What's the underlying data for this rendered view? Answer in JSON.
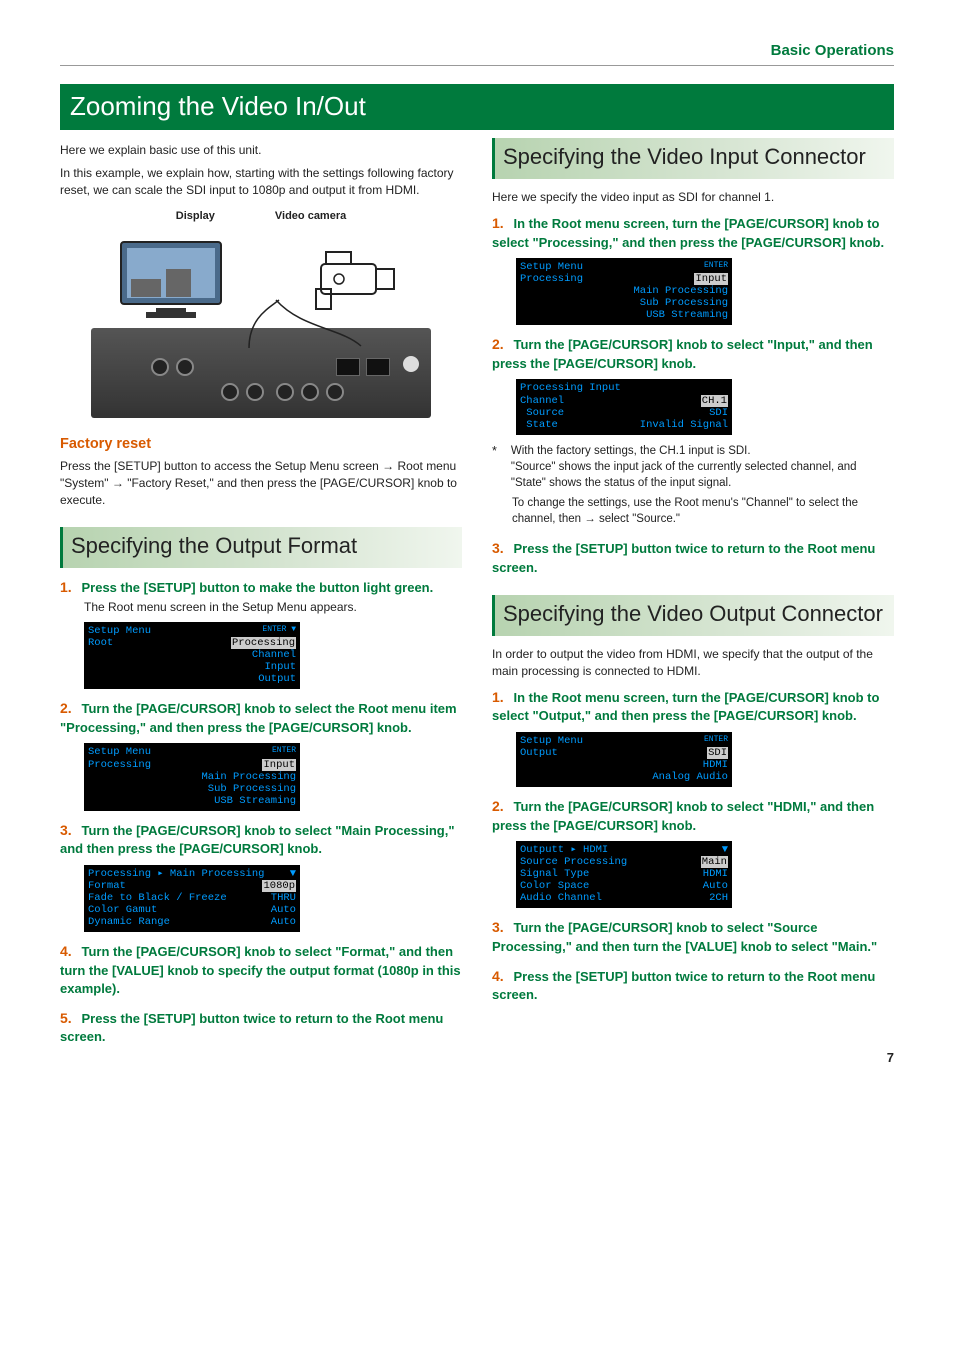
{
  "header": {
    "section": "Basic Operations"
  },
  "title": "Zooming the Video In/Out",
  "intro": {
    "p1": "Here we explain basic use of this unit.",
    "p2": "In this example, we explain how, starting with the settings following factory reset, we can scale the SDI input to 1080p and output it from HDMI."
  },
  "diagram": {
    "display_label": "Display",
    "camera_label": "Video camera"
  },
  "factory_reset": {
    "heading": "Factory reset",
    "body_a": "Press the [SETUP] button to access the Setup Menu screen ",
    "body_b": " Root menu \"System\" ",
    "body_c": " \"Factory Reset,\" and then press the [PAGE/CURSOR] knob to execute."
  },
  "output_format": {
    "heading": "Specifying the Output Format",
    "steps": [
      {
        "num": "1.",
        "heading": "Press the [SETUP] button to make the button light green.",
        "body": "The Root menu screen in the Setup Menu appears."
      },
      {
        "num": "2.",
        "heading": "Turn the [PAGE/CURSOR] knob to select the Root menu item \"Processing,\" and then press the [PAGE/CURSOR] knob."
      },
      {
        "num": "3.",
        "heading": "Turn the [PAGE/CURSOR] knob to select \"Main Processing,\" and then press the [PAGE/CURSOR] knob."
      },
      {
        "num": "4.",
        "heading": "Turn the [PAGE/CURSOR] knob to select \"Format,\" and then turn the [VALUE] knob to specify the output format (1080p in this example)."
      },
      {
        "num": "5.",
        "heading": "Press the [SETUP] button twice to return to the Root menu screen."
      }
    ]
  },
  "input_connector": {
    "heading": "Specifying the Video Input Connector",
    "intro": "Here we specify the video input as SDI for channel 1.",
    "steps": [
      {
        "num": "1.",
        "heading": "In the Root menu screen, turn the [PAGE/CURSOR] knob to select \"Processing,\" and then press the [PAGE/CURSOR] knob."
      },
      {
        "num": "2.",
        "heading": "Turn the [PAGE/CURSOR] knob to select \"Input,\" and then press the [PAGE/CURSOR] knob."
      },
      {
        "num": "3.",
        "heading": "Press the [SETUP] button twice to return to the Root menu screen."
      }
    ],
    "note1": "With the factory settings, the CH.1 input is SDI.",
    "note2": "\"Source\" shows the input jack of the currently selected channel, and \"State\" shows the status of the input signal.",
    "note3a": "To change the settings, use the Root menu's \"Channel\" to select the channel, then ",
    "note3b": " select \"Source.\""
  },
  "output_connector": {
    "heading": "Specifying the Video Output Connector",
    "intro": "In order to output the video from HDMI, we specify that the output of the main processing is connected to HDMI.",
    "steps": [
      {
        "num": "1.",
        "heading": "In the Root menu screen, turn the [PAGE/CURSOR] knob to select \"Output,\" and then press the [PAGE/CURSOR] knob."
      },
      {
        "num": "2.",
        "heading": "Turn the [PAGE/CURSOR] knob to select \"HDMI,\" and then press the [PAGE/CURSOR] knob."
      },
      {
        "num": "3.",
        "heading": "Turn the [PAGE/CURSOR] knob to select \"Source Processing,\" and then turn the [VALUE] knob to select \"Main.\""
      },
      {
        "num": "4.",
        "heading": "Press the [SETUP] button twice to return to the Root menu screen."
      }
    ]
  },
  "menus": {
    "root": {
      "title": "Setup Menu",
      "enter": "ENTER ▼",
      "left": "Root",
      "items": [
        "Processing",
        "Channel",
        "Input",
        "Output"
      ]
    },
    "processing": {
      "title": "Setup Menu",
      "enter": "ENTER",
      "left": "Processing",
      "items": [
        "Input",
        "Main Processing",
        "Sub Processing",
        "USB Streaming"
      ]
    },
    "main_proc": {
      "title": "Processing ▸ Main Processing",
      "arrow": "▼",
      "rows": [
        [
          "Format",
          "1080p"
        ],
        [
          "Fade to Black / Freeze",
          "THRU"
        ],
        [
          "Color Gamut",
          "Auto"
        ],
        [
          "Dynamic Range",
          "Auto"
        ]
      ]
    },
    "proc_input": {
      "title": "Processing Input",
      "rows": [
        [
          "Channel",
          "CH.1"
        ],
        [
          " Source",
          "SDI"
        ],
        [
          " State",
          "Invalid Signal"
        ]
      ]
    },
    "output": {
      "title": "Setup Menu",
      "enter": "ENTER",
      "left": "Output",
      "items": [
        "SDI",
        "HDMI",
        "Analog Audio"
      ]
    },
    "hdmi": {
      "title": "Outputt ▸ HDMI",
      "arrow": "▼",
      "rows": [
        [
          "Source Processing",
          "Main"
        ],
        [
          "Signal Type",
          "HDMI"
        ],
        [
          "Color Space",
          "Auto"
        ],
        [
          "Audio Channel",
          "2CH"
        ]
      ]
    }
  },
  "page_number": "7"
}
